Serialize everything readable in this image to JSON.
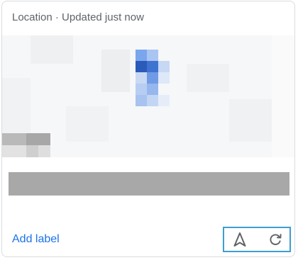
{
  "card": {
    "header_text": "Location · Updated just now"
  },
  "footer": {
    "add_label_text": "Add label"
  },
  "actions": {
    "navigate_icon": "navigation-arrow-icon",
    "refresh_icon": "refresh-icon"
  },
  "colors": {
    "accent": "#1a73e8",
    "header_text": "#5f6368",
    "border": "#dadce0",
    "focus_outline": "#3c9fd0",
    "redacted": "#a8a8a8"
  }
}
